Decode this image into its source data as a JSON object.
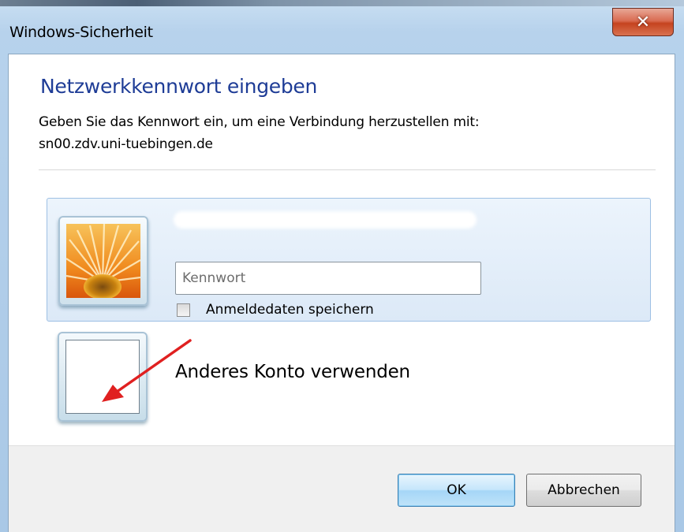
{
  "window": {
    "title": "Windows-Sicherheit",
    "close_icon": "close-icon"
  },
  "dialog": {
    "heading": "Netzwerkkennwort eingeben",
    "description": "Geben Sie das Kennwort ein, um eine Verbindung herzustellen mit:",
    "server": "sn00.zdv.uni-tuebingen.de"
  },
  "account": {
    "avatar_icon": "flower-avatar-icon",
    "password_placeholder": "Kennwort",
    "password_value": "",
    "remember_label": "Anmeldedaten speichern",
    "remember_checked": false
  },
  "other_account": {
    "label": "Anderes Konto verwenden",
    "avatar_icon": "blank-avatar-icon"
  },
  "annotation": {
    "arrow_color": "#e02020"
  },
  "buttons": {
    "ok": "OK",
    "cancel": "Abbrechen"
  }
}
